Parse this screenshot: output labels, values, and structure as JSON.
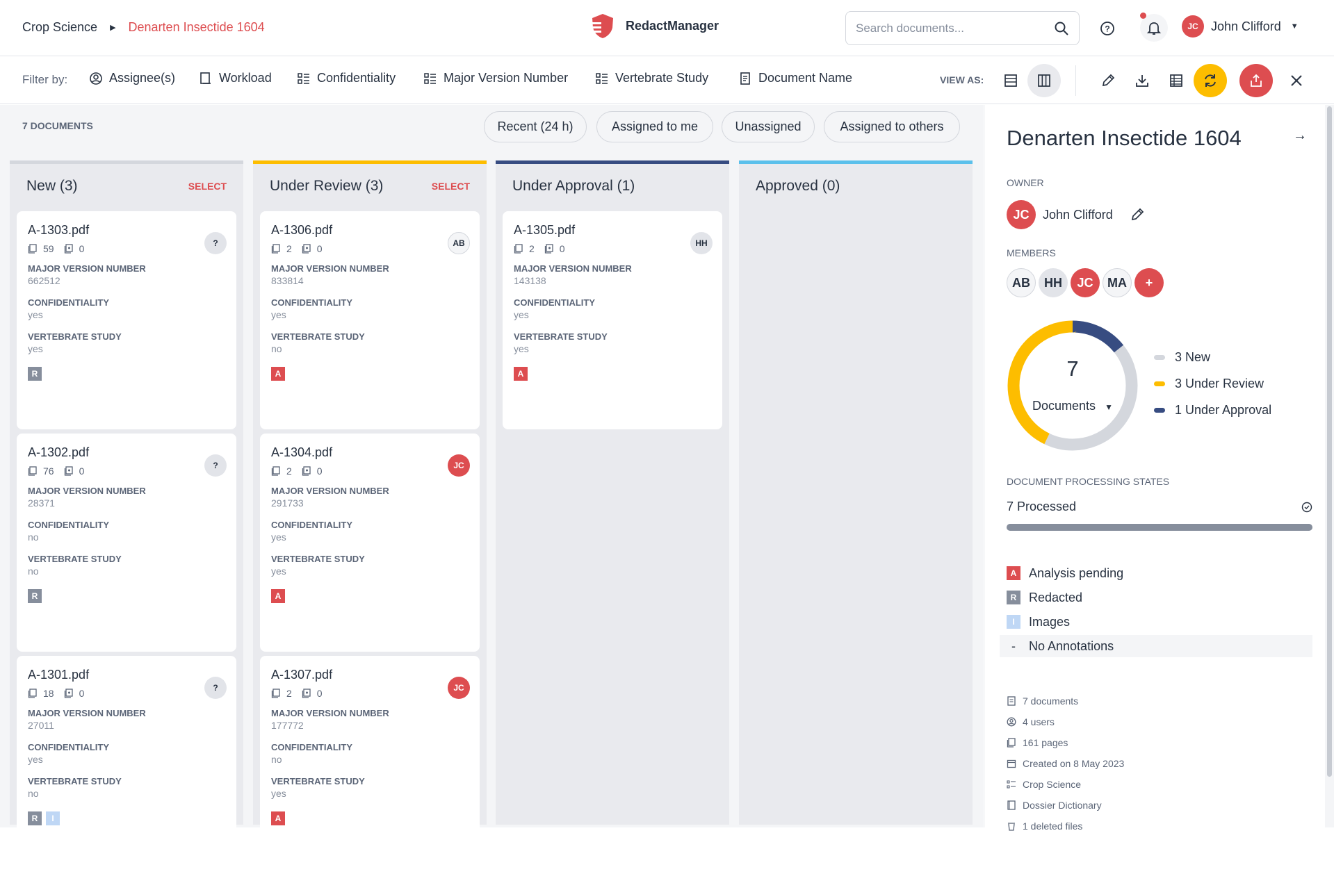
{
  "breadcrumb": {
    "root": "Crop Science",
    "current": "Denarten Insectide 1604"
  },
  "app": {
    "name": "RedactManager"
  },
  "search": {
    "placeholder": "Search documents..."
  },
  "user": {
    "initials": "JC",
    "name": "John Clifford"
  },
  "filters": {
    "label": "Filter by:",
    "items": [
      "Assignee(s)",
      "Workload",
      "Confidentiality",
      "Major Version Number",
      "Vertebrate Study",
      "Document Name"
    ],
    "view_as": "VIEW AS:"
  },
  "documents": {
    "count_label": "7 DOCUMENTS",
    "quick_filters": [
      "Recent (24 h)",
      "Assigned to me",
      "Unassigned",
      "Assigned to others"
    ]
  },
  "labels": {
    "major": "MAJOR VERSION NUMBER",
    "conf": "CONFIDENTIALITY",
    "vert": "VERTEBRATE STUDY",
    "select": "SELECT"
  },
  "columns": [
    {
      "title": "New (3)",
      "color": "#d4d7dd",
      "select": true,
      "cards": [
        {
          "name": "A-1303.pdf",
          "pages": "59",
          "annotations": "0",
          "assignee": "?",
          "assignee_color": "grey",
          "major": "662512",
          "conf": "yes",
          "vert": "yes",
          "badges": [
            "R"
          ]
        },
        {
          "name": "A-1302.pdf",
          "pages": "76",
          "annotations": "0",
          "assignee": "?",
          "assignee_color": "grey",
          "major": "28371",
          "conf": "no",
          "vert": "no",
          "badges": [
            "R"
          ]
        },
        {
          "name": "A-1301.pdf",
          "pages": "18",
          "annotations": "0",
          "assignee": "?",
          "assignee_color": "grey",
          "major": "27011",
          "conf": "yes",
          "vert": "no",
          "badges": [
            "R",
            "I"
          ]
        }
      ]
    },
    {
      "title": "Under Review (3)",
      "color": "#fdbd00",
      "select": true,
      "cards": [
        {
          "name": "A-1306.pdf",
          "pages": "2",
          "annotations": "0",
          "assignee": "AB",
          "assignee_color": "outline",
          "major": "833814",
          "conf": "yes",
          "vert": "no",
          "badges": [
            "A"
          ]
        },
        {
          "name": "A-1304.pdf",
          "pages": "2",
          "annotations": "0",
          "assignee": "JC",
          "assignee_color": "red",
          "major": "291733",
          "conf": "yes",
          "vert": "yes",
          "badges": [
            "A"
          ]
        },
        {
          "name": "A-1307.pdf",
          "pages": "2",
          "annotations": "0",
          "assignee": "JC",
          "assignee_color": "red",
          "major": "177772",
          "conf": "no",
          "vert": "yes",
          "badges": [
            "A"
          ]
        }
      ]
    },
    {
      "title": "Under Approval (1)",
      "color": "#374c81",
      "select": false,
      "cards": [
        {
          "name": "A-1305.pdf",
          "pages": "2",
          "annotations": "0",
          "assignee": "HH",
          "assignee_color": "grey",
          "major": "143138",
          "conf": "yes",
          "vert": "yes",
          "badges": [
            "A"
          ]
        }
      ]
    },
    {
      "title": "Approved (0)",
      "color": "#5bc0eb",
      "select": false,
      "cards": []
    }
  ],
  "sidebar": {
    "title": "Denarten Insectide 1604",
    "owner_label": "OWNER",
    "owner": {
      "initials": "JC",
      "name": "John Clifford"
    },
    "members_label": "MEMBERS",
    "members": [
      "AB",
      "HH",
      "JC",
      "MA"
    ],
    "add_member": "+",
    "donut": {
      "total": "7",
      "label": "Documents"
    },
    "legend": [
      {
        "label": "3 New",
        "value": 3,
        "color": "#d4d7dd"
      },
      {
        "label": "3 Under Review",
        "value": 3,
        "color": "#fdbd00"
      },
      {
        "label": "1 Under Approval",
        "value": 1,
        "color": "#374c81"
      }
    ],
    "processing_label": "DOCUMENT PROCESSING STATES",
    "processed": "7 Processed",
    "processed_fraction": 1.0,
    "states": [
      {
        "badge": "A",
        "label": "Analysis pending"
      },
      {
        "badge": "R",
        "label": "Redacted"
      },
      {
        "badge": "I",
        "label": "Images"
      },
      {
        "badge": "-",
        "label": "No Annotations"
      }
    ],
    "meta": [
      "7 documents",
      "4 users",
      "161 pages",
      "Created on 8 May 2023",
      "Crop Science",
      "Dossier Dictionary",
      "1 deleted files"
    ]
  },
  "colors": {
    "accent": "#dd4d50",
    "yellow": "#fdbd00",
    "navy": "#374c81",
    "light_blue": "#5bc0eb"
  }
}
